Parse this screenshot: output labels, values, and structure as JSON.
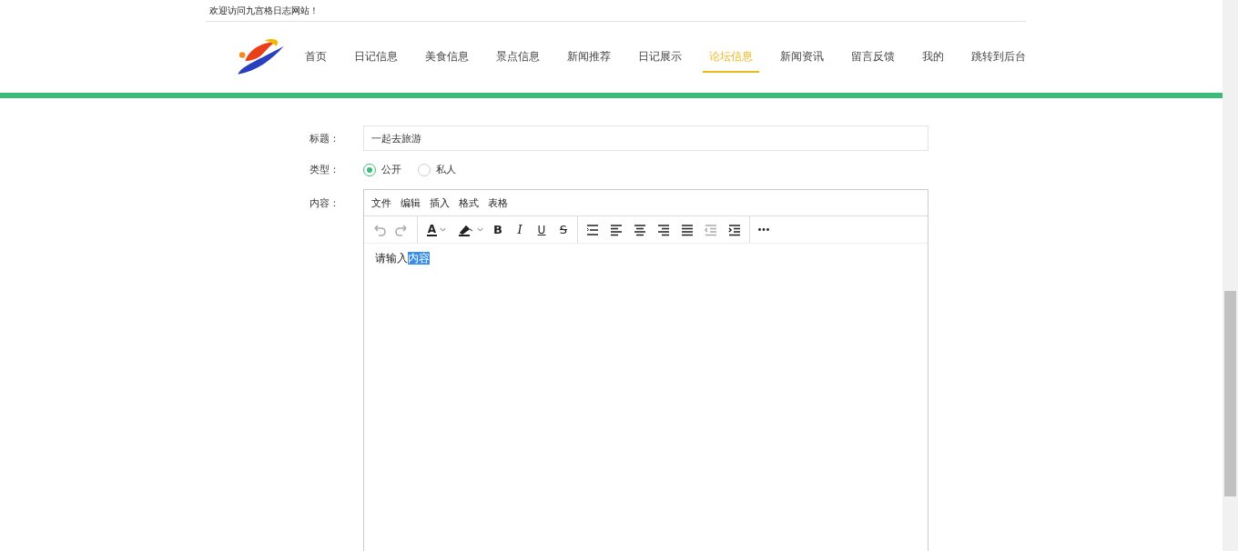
{
  "welcome": "欢迎访问九宫格日志网站！",
  "nav": [
    {
      "label": "首页",
      "selected": false
    },
    {
      "label": "日记信息",
      "selected": false
    },
    {
      "label": "美食信息",
      "selected": false
    },
    {
      "label": "景点信息",
      "selected": false
    },
    {
      "label": "新闻推荐",
      "selected": false
    },
    {
      "label": "日记展示",
      "selected": false
    },
    {
      "label": "论坛信息",
      "selected": true
    },
    {
      "label": "新闻资讯",
      "selected": false
    },
    {
      "label": "留言反馈",
      "selected": false
    },
    {
      "label": "我的",
      "selected": false
    },
    {
      "label": "跳转到后台",
      "selected": false
    }
  ],
  "form": {
    "title_label": "标题：",
    "title_value": "一起去旅游",
    "type_label": "类型：",
    "type_options": [
      {
        "label": "公开",
        "selected": true
      },
      {
        "label": "私人",
        "selected": false
      }
    ],
    "content_label": "内容：",
    "editor": {
      "menu": [
        "文件",
        "编辑",
        "插入",
        "格式",
        "表格"
      ],
      "toolbar": [
        {
          "kind": "undo",
          "disabled": true
        },
        {
          "kind": "redo",
          "disabled": true
        },
        {
          "kind": "sep"
        },
        {
          "kind": "forecolor",
          "label": "A",
          "disabled": false
        },
        {
          "kind": "backcolor",
          "disabled": false
        },
        {
          "kind": "bold",
          "label": "B",
          "disabled": false
        },
        {
          "kind": "italic",
          "label": "I",
          "disabled": false
        },
        {
          "kind": "underline",
          "label": "U",
          "disabled": false
        },
        {
          "kind": "strike",
          "label": "S",
          "disabled": false
        },
        {
          "kind": "sep"
        },
        {
          "kind": "lineheight",
          "disabled": false
        },
        {
          "kind": "alignleft",
          "disabled": false
        },
        {
          "kind": "aligncenter",
          "disabled": false
        },
        {
          "kind": "alignright",
          "disabled": false
        },
        {
          "kind": "justify",
          "disabled": false
        },
        {
          "kind": "outdent",
          "disabled": true
        },
        {
          "kind": "indent",
          "disabled": false
        },
        {
          "kind": "sep"
        },
        {
          "kind": "more",
          "disabled": false
        }
      ],
      "text": "请输入",
      "selected_text": "内容"
    }
  }
}
